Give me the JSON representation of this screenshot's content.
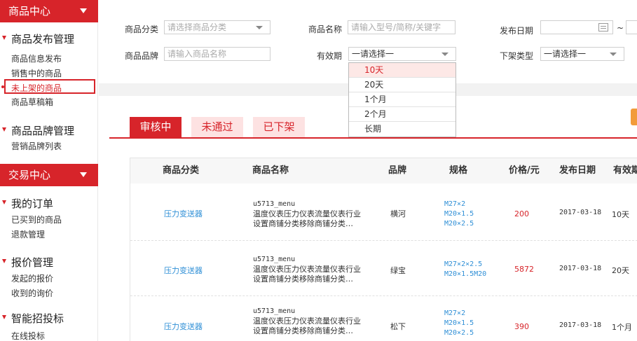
{
  "sidebar": {
    "product_center": "商品中心",
    "publish_group": "商品发布管理",
    "publish_items": [
      "商品信息发布",
      "销售中的商品",
      "未上架的商品",
      "商品草稿箱"
    ],
    "brand_group": "商品品牌管理",
    "brand_items": [
      "营销品牌列表"
    ],
    "trade_center": "交易中心",
    "order_group": "我的订单",
    "order_items": [
      "已买到的商品",
      "退款管理"
    ],
    "quote_group": "报价管理",
    "quote_items": [
      "发起的报价",
      "收到的询价"
    ],
    "bid_group": "智能招投标",
    "bid_items": [
      "在线投标"
    ]
  },
  "filters": {
    "category_label": "商品分类",
    "category_placeholder": "请选择商品分类",
    "name_label": "商品名称",
    "name_placeholder": "请输入型号/简称/关键字",
    "date_label": "发布日期",
    "date_sep": "~",
    "brand_label": "商品品牌",
    "brand_placeholder": "请输入商品名称",
    "validity_label": "有效期",
    "validity_value": "一请选择一",
    "offshelf_label": "下架类型",
    "offshelf_value": "一请选择一"
  },
  "validity_options": [
    "10天",
    "20天",
    "1个月",
    "2个月",
    "长期"
  ],
  "tabs": [
    "审核中",
    "未通过",
    "已下架"
  ],
  "table": {
    "headers": [
      "商品分类",
      "商品名称",
      "品牌",
      "规格",
      "价格/元",
      "发布日期",
      "有效期"
    ],
    "rows": [
      {
        "category": "压力变送器",
        "name_code": "u5713_menu",
        "name_line1": "温度仪表压力仪表流量仪表行业",
        "name_line2": "设置商铺分类移除商铺分类…",
        "brand": "横河",
        "specs": [
          "M27×2",
          "M20×1.5",
          "M20×2.5"
        ],
        "price": "200",
        "date": "2017-03-18",
        "validity": "10天"
      },
      {
        "category": "压力变送器",
        "name_code": "u5713_menu",
        "name_line1": "温度仪表压力仪表流量仪表行业",
        "name_line2": "设置商铺分类移除商铺分类…",
        "brand": "绿宝",
        "specs": [
          "M27×2×2.5",
          "M20×1.5M20"
        ],
        "price": "5872",
        "date": "2017-03-18",
        "validity": "20天"
      },
      {
        "category": "压力变送器",
        "name_code": "u5713_menu",
        "name_line1": "温度仪表压力仪表流量仪表行业",
        "name_line2": "设置商铺分类移除商铺分类…",
        "brand": "松下",
        "specs": [
          "M27×2",
          "M20×1.5",
          "M20×2.5"
        ],
        "price": "390",
        "date": "2017-03-18",
        "validity": "1个月"
      }
    ]
  },
  "colors": {
    "accent": "#d7242a",
    "link": "#2f8fd6",
    "tab_inactive_bg": "#fde2e2",
    "highlight": "#fde8e6",
    "orange": "#f29b3a"
  }
}
